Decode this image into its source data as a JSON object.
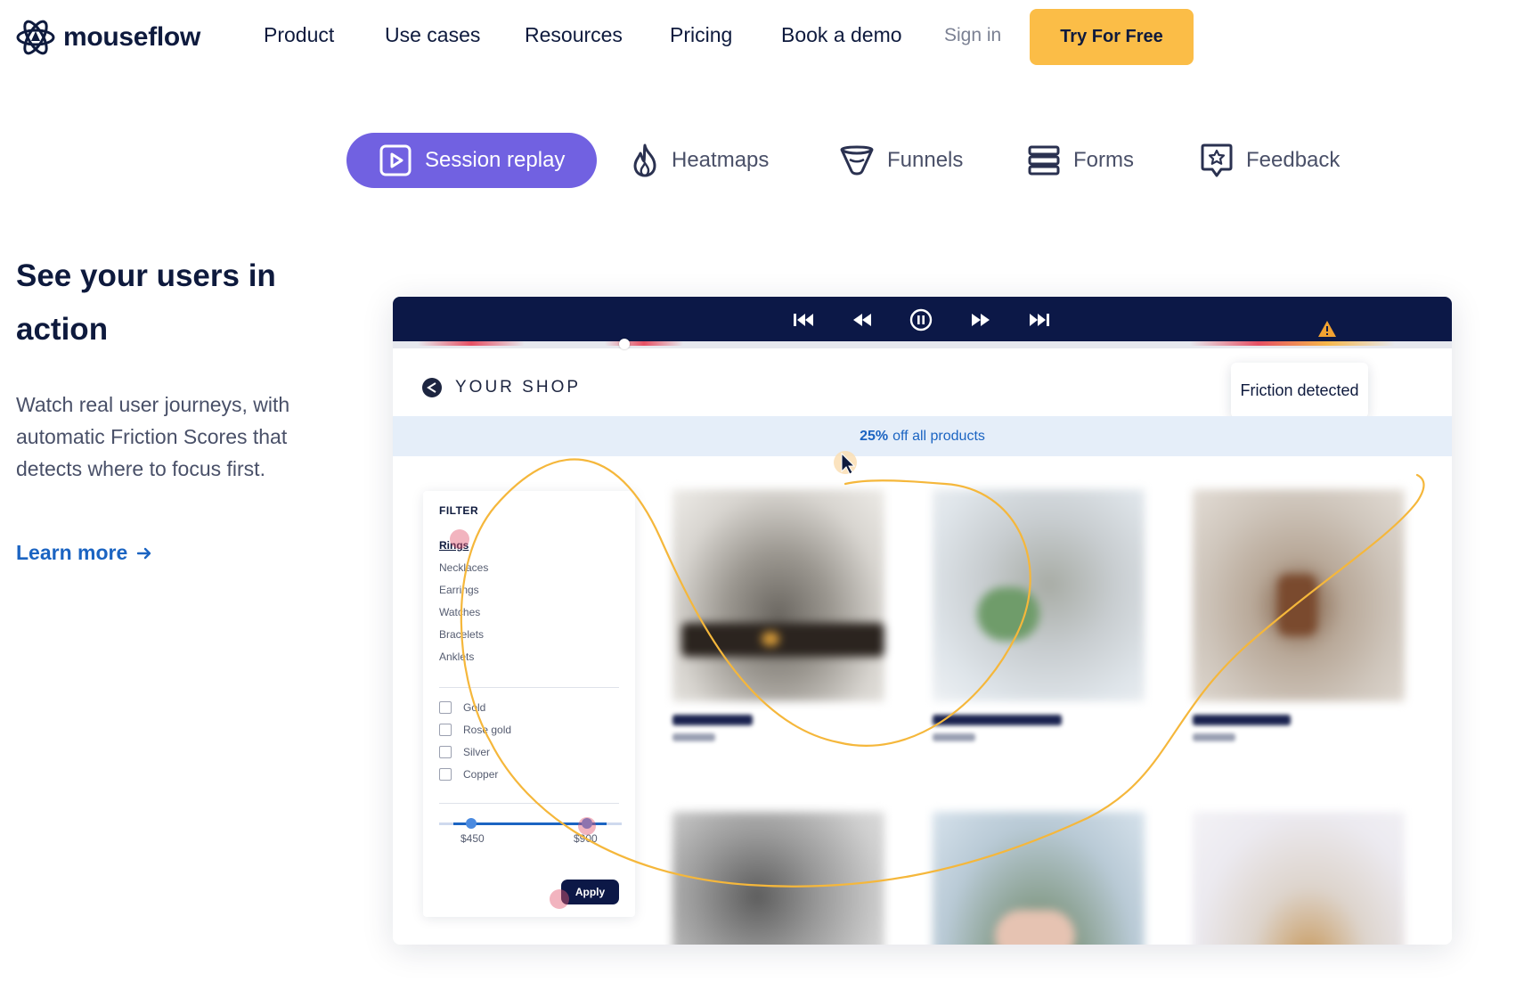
{
  "nav": {
    "brand": "mouseflow",
    "links": [
      "Product",
      "Use cases",
      "Resources",
      "Pricing",
      "Book a demo"
    ],
    "signin": "Sign in",
    "cta": "Try For Free"
  },
  "tabs": [
    {
      "label": "Session replay",
      "icon": "play-square-icon",
      "active": true
    },
    {
      "label": "Heatmaps",
      "icon": "flame-icon",
      "active": false
    },
    {
      "label": "Funnels",
      "icon": "funnel-icon",
      "active": false
    },
    {
      "label": "Forms",
      "icon": "form-stack-icon",
      "active": false
    },
    {
      "label": "Feedback",
      "icon": "star-badge-icon",
      "active": false
    }
  ],
  "hero": {
    "title": "See your users in action",
    "description": "Watch real user journeys, with automatic Friction Scores that detects where to focus first.",
    "link": "Learn more"
  },
  "mockup": {
    "shop_name": "YOUR SHOP",
    "friction_label": "Friction detected",
    "promo_bold": "25%",
    "promo_rest": "off all products",
    "filter": {
      "title": "FILTER",
      "categories": [
        "Rings",
        "Necklaces",
        "Earrings",
        "Watches",
        "Bracelets",
        "Anklets"
      ],
      "materials": [
        "Gold",
        "Rose gold",
        "Silver",
        "Copper"
      ],
      "price_min": "$450",
      "price_max": "$900",
      "apply": "Apply"
    }
  },
  "colors": {
    "accent": "#7161e1",
    "cta": "#fbbd47",
    "navy": "#0c1847",
    "link": "#1b64c2",
    "path": "#f5b73b"
  }
}
